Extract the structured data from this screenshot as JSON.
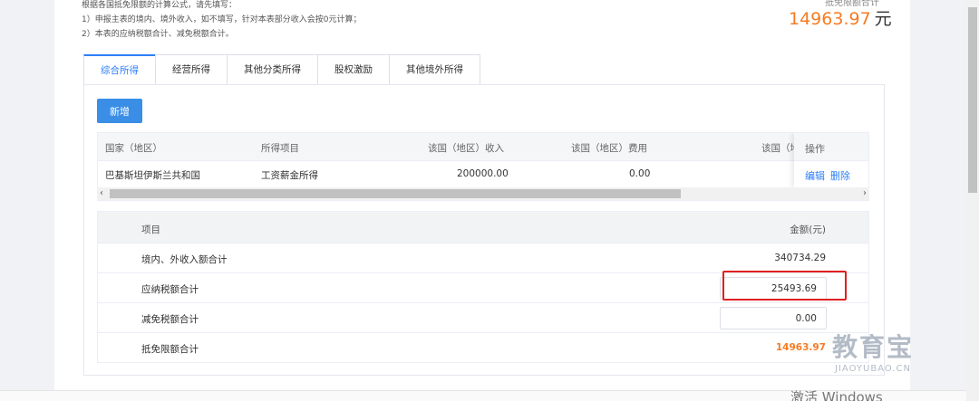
{
  "header": {
    "hint_line1": "根据各国抵免限额的计算公式，请先填写：",
    "hint_line2": "1）申报主表的境内、境外收入，如不填写，针对本表部分收入会按0元计算；",
    "hint_line3": "2）本表的应纳税额合计、减免税额合计。",
    "total_label": "抵免限额合计",
    "total_amount": "14963.97",
    "total_unit": "元"
  },
  "tabs": [
    {
      "label": "综合所得",
      "active": true
    },
    {
      "label": "经营所得",
      "active": false
    },
    {
      "label": "其他分类所得",
      "active": false
    },
    {
      "label": "股权激励",
      "active": false
    },
    {
      "label": "其他境外所得",
      "active": false
    }
  ],
  "add_button_label": "新增",
  "grid": {
    "columns": [
      "国家（地区）",
      "所得项目",
      "该国（地区）收入",
      "该国（地区）费用",
      "该国（地"
    ],
    "op_header": "操作",
    "rows": [
      {
        "country": "巴基斯坦伊斯兰共和国",
        "item": "工资薪金所得",
        "income": "200000.00",
        "expense": "0.00"
      }
    ],
    "actions": {
      "edit": "编辑",
      "delete": "删除"
    },
    "scroll_left": "‹",
    "scroll_right": "›"
  },
  "summary": {
    "header_item": "项目",
    "header_amount": "金额(元)",
    "rows": [
      {
        "label": "境内、外收入额合计",
        "value": "340734.29"
      },
      {
        "label": "应纳税额合计",
        "value": "25493.69"
      },
      {
        "label": "减免税额合计",
        "value": "0.00"
      },
      {
        "label": "抵免限额合计",
        "value": "14963.97"
      }
    ]
  },
  "watermark": {
    "brand": "教育宝",
    "domain": "JIAOYUBAO.CN"
  },
  "activate_text": "激活 Windows",
  "colors": {
    "accent": "#2d7ff9",
    "amount": "#f57c23",
    "highlight": "#e02020"
  }
}
